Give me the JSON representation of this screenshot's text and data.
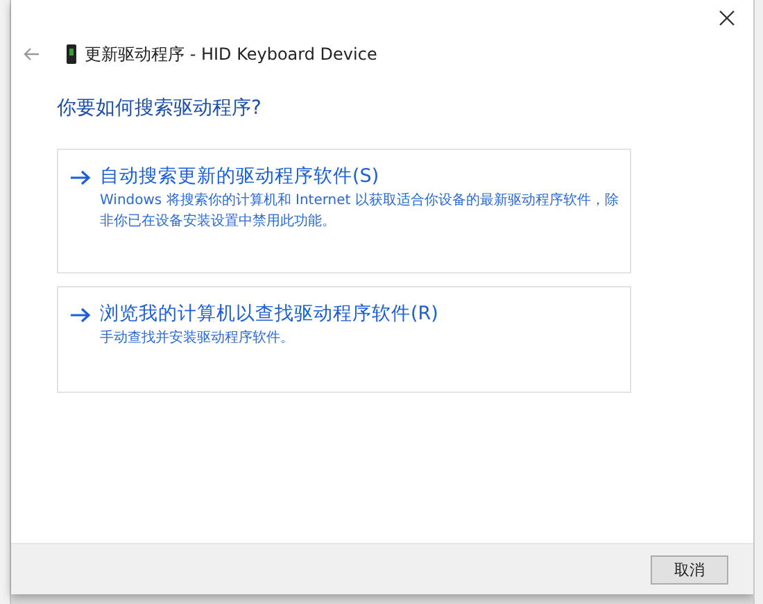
{
  "window": {
    "title": "更新驱动程序 - HID Keyboard Device"
  },
  "heading": "你要如何搜索驱动程序?",
  "options": [
    {
      "title": "自动搜索更新的驱动程序软件(S)",
      "description": "Windows 将搜索你的计算机和 Internet 以获取适合你设备的最新驱动程序软件，除非你已在设备安装设置中禁用此功能。"
    },
    {
      "title": "浏览我的计算机以查找驱动程序软件(R)",
      "description": "手动查找并安装驱动程序软件。"
    }
  ],
  "buttons": [
    "取消"
  ]
}
